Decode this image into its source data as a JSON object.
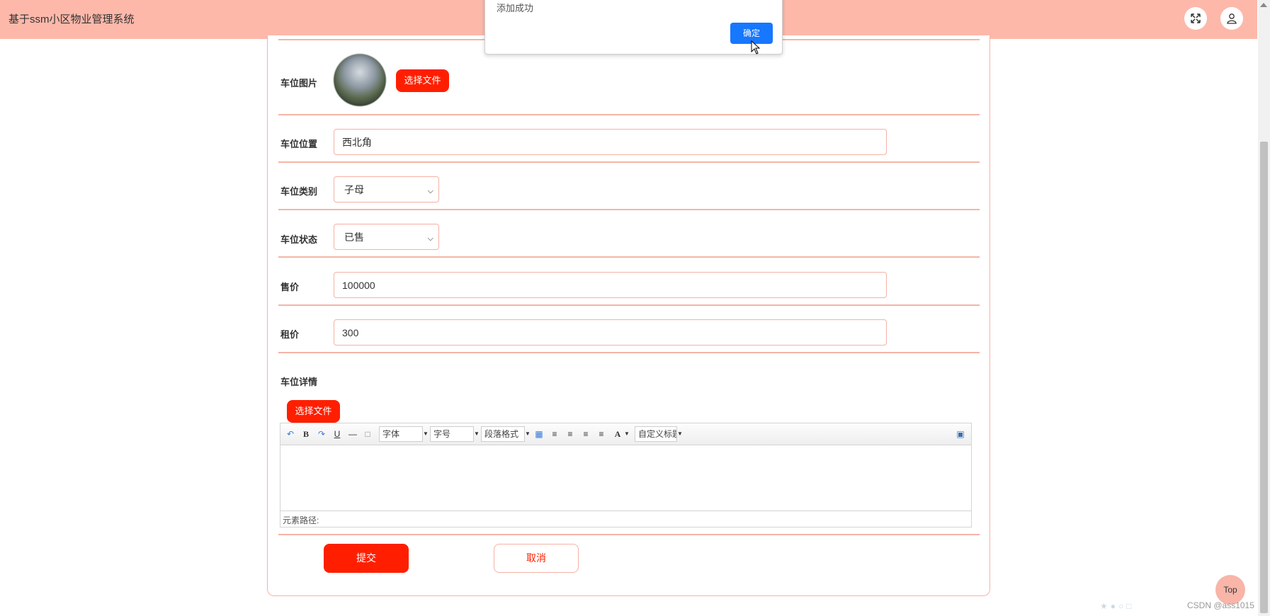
{
  "header": {
    "app_title": "基于ssm小区物业管理系统",
    "fullscreen_icon": "fullscreen-icon",
    "user_icon": "user-icon",
    "bg_color": "#fdb8aa"
  },
  "dialog": {
    "message": "添加成功",
    "ok_label": "确定"
  },
  "form": {
    "image": {
      "label": "车位图片",
      "choose_label": "选择文件"
    },
    "location": {
      "label": "车位位置",
      "value": "西北角"
    },
    "category": {
      "label": "车位类别",
      "value": "子母"
    },
    "status": {
      "label": "车位状态",
      "value": "已售"
    },
    "sale_price": {
      "label": "售价",
      "value": "100000"
    },
    "rent_price": {
      "label": "租价",
      "value": "300"
    },
    "detail": {
      "label": "车位详情",
      "choose_label": "选择文件",
      "toolbar": {
        "font_family": "字体",
        "font_size": "字号",
        "paragraph": "段落格式",
        "custom_title": "自定义标题",
        "bold": "B",
        "underline": "U",
        "font_color": "A"
      },
      "element_path": "元素路径:"
    },
    "submit_label": "提交",
    "cancel_label": "取消"
  },
  "top_button": "Top",
  "watermark": "CSDN @ass1015",
  "colors": {
    "accent_red": "#ff1f00",
    "dialog_blue": "#1677ff",
    "border_pink": "#f4b2a5"
  }
}
